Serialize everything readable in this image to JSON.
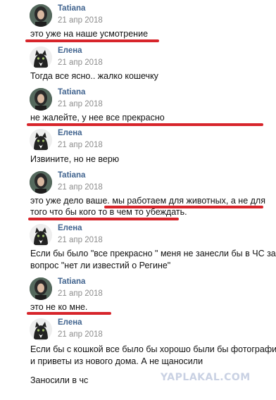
{
  "messages": [
    {
      "author": "Tatiana",
      "date": "21 апр 2018",
      "lines": [
        "это уже на наше усмотрение"
      ]
    },
    {
      "author": "Елена",
      "date": "21 апр 2018",
      "lines": [
        "Тогда все ясно.. жалко кошечку"
      ]
    },
    {
      "author": "Tatiana",
      "date": "21 апр 2018",
      "lines": [
        "не жалейте, у нее все прекрасно"
      ]
    },
    {
      "author": "Елена",
      "date": "21 апр 2018",
      "lines": [
        "Извините, но не верю"
      ]
    },
    {
      "author": "Tatiana",
      "date": "21 апр 2018",
      "lines": [
        "это уже дело ваше. мы работаем для животных, а не для",
        "того что бы кого то в чем то убеждать."
      ]
    },
    {
      "author": "Елена",
      "date": "21 апр 2018",
      "lines": [
        "Если бы было \"все прекрасно \" меня не занесли бы в ЧС за",
        "вопрос \"нет ли известий о Регине\""
      ]
    },
    {
      "author": "Tatiana",
      "date": "21 апр 2018",
      "lines": [
        "это не ко мне."
      ]
    },
    {
      "author": "Елена",
      "date": "21 апр 2018",
      "lines": [
        "Если бы с кошкой все было бы хорошо были бы фотографии",
        "и приветы из нового дома. А не щаносили",
        "",
        "Заносили в чс"
      ]
    }
  ],
  "watermark": "YAPLAKAL.COM",
  "colors": {
    "author": "#41648f",
    "date": "#8c8c8c",
    "underline": "#d7252b",
    "text": "#111111"
  }
}
